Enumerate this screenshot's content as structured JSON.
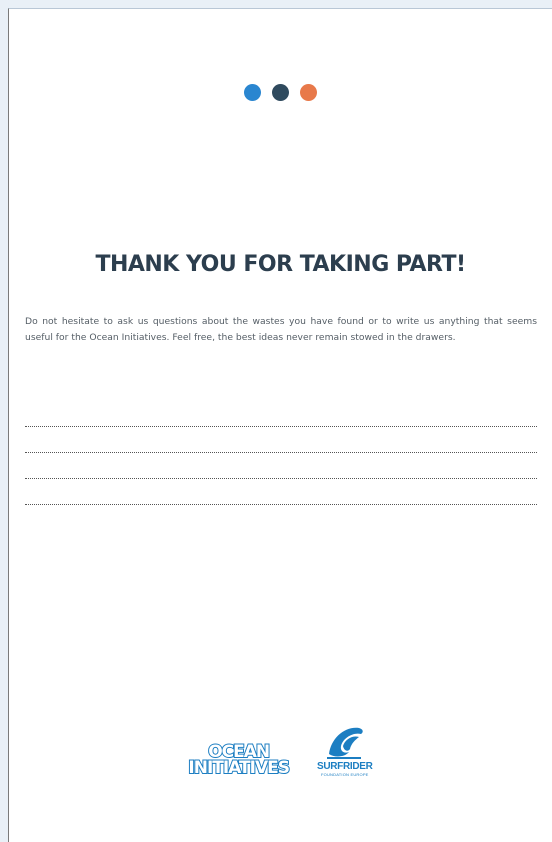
{
  "colors": {
    "dot_1": "#2a86d0",
    "dot_2": "#2f4a5e",
    "dot_3": "#e8794a",
    "heading": "#2c3e4e",
    "brand_blue": "#1c7ec2"
  },
  "heading": "THANK YOU FOR TAKING PART!",
  "body_text": "Do not hesitate to ask us questions about the wastes you have found or to write us anything that seems useful for the Ocean Initiatives. Feel free, the best ideas never remain stowed in the drawers.",
  "write_lines_count": 4,
  "logos": {
    "ocean_initiatives": {
      "line1": "OCEAN",
      "line2": "INITIATIVES"
    },
    "surfrider": {
      "name": "SURFRIDER",
      "subtitle": "FOUNDATION EUROPE"
    }
  }
}
